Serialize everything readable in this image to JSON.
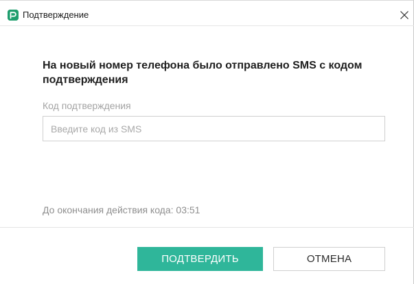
{
  "window": {
    "title": "Подтверждение",
    "app_icon": "app-logo-icon",
    "close_icon": "close-icon"
  },
  "main": {
    "heading": "На новый номер телефона было отправлено SMS с кодом подтверждения",
    "code_label": "Код подтверждения",
    "code_input": {
      "value": "",
      "placeholder": "Введите код из SMS"
    },
    "timer_text": "До окончания действия кода: 03:51"
  },
  "actions": {
    "confirm_label": "ПОДТВЕРДИТЬ",
    "cancel_label": "ОТМЕНА"
  },
  "colors": {
    "accent": "#2fb69a",
    "app_icon": "#1f9e6e"
  }
}
